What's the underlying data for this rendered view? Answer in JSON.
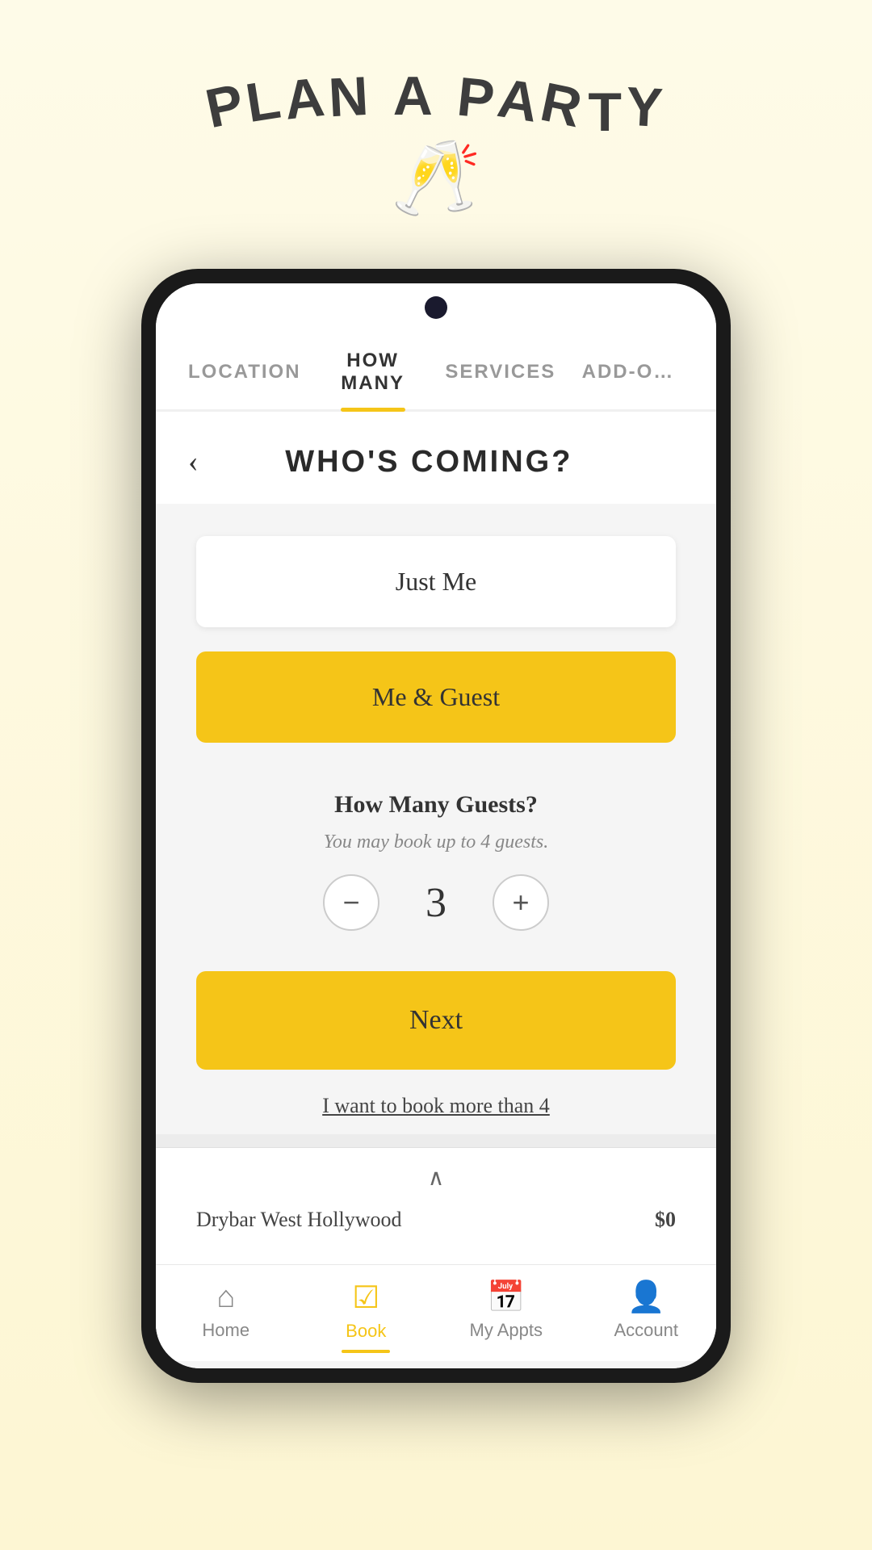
{
  "header": {
    "title": "PLAN A PARTY",
    "title_letters": [
      "P",
      "L",
      "A",
      "N",
      " ",
      "A",
      " ",
      "P",
      "A",
      "R",
      "T",
      "Y"
    ]
  },
  "tabs": [
    {
      "id": "location",
      "label": "LOCATION",
      "active": false
    },
    {
      "id": "how-many",
      "label": "HOW MANY",
      "active": true
    },
    {
      "id": "services",
      "label": "SERVICES",
      "active": false
    },
    {
      "id": "add-ons",
      "label": "ADD-O…",
      "active": false
    }
  ],
  "page": {
    "title": "WHO'S COMING?",
    "back_label": "‹"
  },
  "options": [
    {
      "id": "just-me",
      "label": "Just Me",
      "style": "white"
    },
    {
      "id": "me-and-guest",
      "label": "Me & Guest",
      "style": "yellow"
    }
  ],
  "guests_section": {
    "title": "How Many Guests?",
    "subtitle": "You may book up to 4 guests.",
    "count": "3",
    "minus_label": "−",
    "plus_label": "+"
  },
  "next_btn": {
    "label": "Next"
  },
  "book_more": {
    "label": "I want to book more than 4"
  },
  "bottom_bar": {
    "chevron": "∧",
    "location": "Drybar West Hollywood",
    "price": "$0"
  },
  "nav": [
    {
      "id": "home",
      "label": "Home",
      "icon": "⌂",
      "active": false
    },
    {
      "id": "book",
      "label": "Book",
      "icon": "☑",
      "active": true
    },
    {
      "id": "my-appts",
      "label": "My Appts",
      "icon": "📅",
      "active": false
    },
    {
      "id": "account",
      "label": "Account",
      "icon": "👤",
      "active": false
    }
  ]
}
